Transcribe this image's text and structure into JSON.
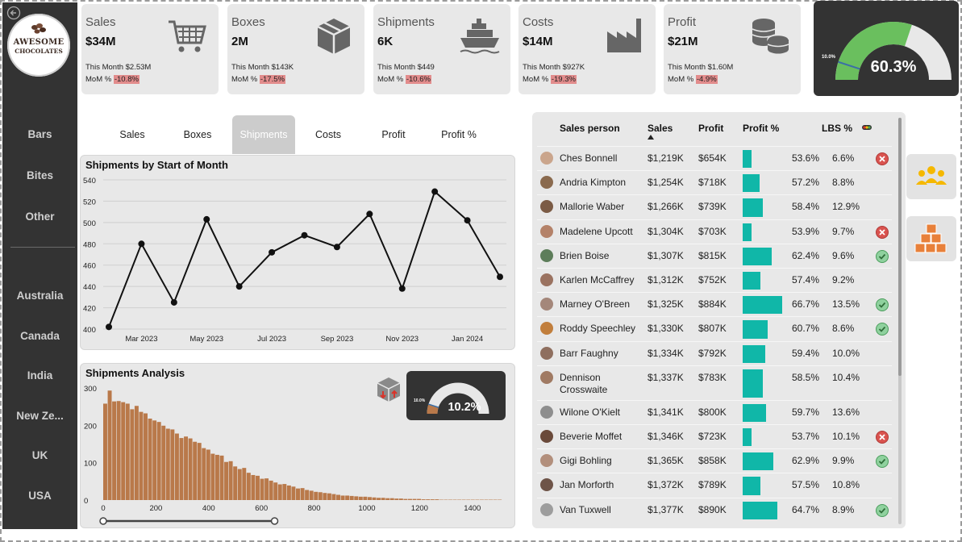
{
  "brand": {
    "line1": "AWESOME",
    "line2": "CHOCOLATES"
  },
  "nav": {
    "categories": [
      "Bars",
      "Bites",
      "Other"
    ],
    "countries": [
      "Australia",
      "Canada",
      "India",
      "New Ze...",
      "UK",
      "USA"
    ]
  },
  "kpis": [
    {
      "label": "Sales",
      "value": "$34M",
      "month": "This Month $2.53M",
      "mom_prefix": "MoM % ",
      "mom": "-10.8%",
      "icon": "cart-icon"
    },
    {
      "label": "Boxes",
      "value": "2M",
      "month": "This Month $143K",
      "mom_prefix": "MoM % ",
      "mom": "-17.5%",
      "icon": "box-icon"
    },
    {
      "label": "Shipments",
      "value": "6K",
      "month": "This Month $449",
      "mom_prefix": "MoM % ",
      "mom": "-10.6%",
      "icon": "ship-icon"
    },
    {
      "label": "Costs",
      "value": "$14M",
      "month": "This Month $927K",
      "mom_prefix": "MoM % ",
      "mom": "-19.3%",
      "icon": "factory-icon"
    },
    {
      "label": "Profit",
      "value": "$21M",
      "month": "This Month $1.60M",
      "mom_prefix": "MoM % ",
      "mom": "-4.9%",
      "icon": "coins-icon"
    }
  ],
  "profit_gauge": {
    "value": "60.3%",
    "target_label": "10.0%",
    "fraction": 0.603,
    "target_fraction": 0.1,
    "colors": {
      "fill": "#6abf5e",
      "track": "#e8e8e8"
    }
  },
  "tabs": [
    "Sales",
    "Boxes",
    "Shipments",
    "Costs",
    "Profit",
    "Profit %"
  ],
  "active_tab": "Shipments",
  "line_chart": {
    "title": "Shipments by Start of Month",
    "chart_data": {
      "type": "line",
      "x": [
        "Feb 2023",
        "Mar 2023",
        "Apr 2023",
        "May 2023",
        "Jun 2023",
        "Jul 2023",
        "Aug 2023",
        "Sep 2023",
        "Oct 2023",
        "Nov 2023",
        "Dec 2023",
        "Jan 2024",
        "Feb 2024"
      ],
      "y": [
        402,
        480,
        425,
        503,
        440,
        472,
        488,
        477,
        508,
        438,
        529,
        502,
        449
      ],
      "x_ticks": [
        "Mar 2023",
        "May 2023",
        "Jul 2023",
        "Sep 2023",
        "Nov 2023",
        "Jan 2024"
      ],
      "y_ticks": [
        400,
        420,
        440,
        460,
        480,
        500,
        520,
        540
      ],
      "ylim": [
        400,
        540
      ]
    }
  },
  "histogram": {
    "title": "Shipments Analysis",
    "chart_data": {
      "type": "bar",
      "bin_width": 17,
      "values": [
        258,
        293,
        264,
        265,
        262,
        258,
        243,
        252,
        236,
        232,
        218,
        213,
        209,
        199,
        191,
        189,
        178,
        166,
        170,
        165,
        156,
        153,
        139,
        135,
        124,
        121,
        119,
        102,
        104,
        90,
        83,
        86,
        73,
        67,
        65,
        57,
        58,
        52,
        47,
        42,
        43,
        39,
        36,
        31,
        32,
        27,
        25,
        22,
        21,
        19,
        18,
        16,
        14,
        12,
        12,
        11,
        10,
        9,
        9,
        8,
        7,
        6,
        6,
        5,
        5,
        4,
        4,
        3,
        3,
        3,
        3,
        2,
        2,
        2,
        2,
        1,
        1,
        1,
        1,
        1,
        1,
        1,
        1,
        1,
        1,
        1,
        1,
        1,
        1
      ],
      "x_ticks": [
        0,
        200,
        400,
        600,
        800,
        1000,
        1200,
        1400
      ],
      "y_ticks": [
        0,
        100,
        200,
        300
      ],
      "xlim": [
        0,
        1520
      ],
      "ylim": [
        0,
        300
      ],
      "color": "#b9794a"
    },
    "slider_range": [
      0,
      650
    ]
  },
  "mini_gauge": {
    "value": "10.2%",
    "target_label": "10.0%",
    "fraction": 0.102
  },
  "table": {
    "headers": [
      "Sales person",
      "Sales",
      "Profit",
      "Profit %",
      "LBS %"
    ],
    "rows": [
      {
        "name": "Ches Bonnell",
        "sales": "$1,219K",
        "profit": "$654K",
        "pct": "53.6%",
        "pct_value": 53.6,
        "lbs": "6.6%",
        "status": "x"
      },
      {
        "name": "Andria Kimpton",
        "sales": "$1,254K",
        "profit": "$718K",
        "pct": "57.2%",
        "pct_value": 57.2,
        "lbs": "8.8%",
        "status": ""
      },
      {
        "name": "Mallorie Waber",
        "sales": "$1,266K",
        "profit": "$739K",
        "pct": "58.4%",
        "pct_value": 58.4,
        "lbs": "12.9%",
        "status": ""
      },
      {
        "name": "Madelene Upcott",
        "sales": "$1,304K",
        "profit": "$703K",
        "pct": "53.9%",
        "pct_value": 53.9,
        "lbs": "9.7%",
        "status": "x"
      },
      {
        "name": "Brien Boise",
        "sales": "$1,307K",
        "profit": "$815K",
        "pct": "62.4%",
        "pct_value": 62.4,
        "lbs": "9.6%",
        "status": "ok"
      },
      {
        "name": "Karlen McCaffrey",
        "sales": "$1,312K",
        "profit": "$752K",
        "pct": "57.4%",
        "pct_value": 57.4,
        "lbs": "9.2%",
        "status": ""
      },
      {
        "name": "Marney O'Breen",
        "sales": "$1,325K",
        "profit": "$884K",
        "pct": "66.7%",
        "pct_value": 66.7,
        "lbs": "13.5%",
        "status": "ok"
      },
      {
        "name": "Roddy Speechley",
        "sales": "$1,330K",
        "profit": "$807K",
        "pct": "60.7%",
        "pct_value": 60.7,
        "lbs": "8.6%",
        "status": "ok"
      },
      {
        "name": "Barr Faughny",
        "sales": "$1,334K",
        "profit": "$792K",
        "pct": "59.4%",
        "pct_value": 59.4,
        "lbs": "10.0%",
        "status": ""
      },
      {
        "name": "Dennison Crosswaite",
        "sales": "$1,337K",
        "profit": "$783K",
        "pct": "58.5%",
        "pct_value": 58.5,
        "lbs": "10.4%",
        "status": ""
      },
      {
        "name": "Wilone O'Kielt",
        "sales": "$1,341K",
        "profit": "$800K",
        "pct": "59.7%",
        "pct_value": 59.7,
        "lbs": "13.6%",
        "status": ""
      },
      {
        "name": "Beverie Moffet",
        "sales": "$1,346K",
        "profit": "$723K",
        "pct": "53.7%",
        "pct_value": 53.7,
        "lbs": "10.1%",
        "status": "x"
      },
      {
        "name": "Gigi Bohling",
        "sales": "$1,365K",
        "profit": "$858K",
        "pct": "62.9%",
        "pct_value": 62.9,
        "lbs": "9.9%",
        "status": "ok"
      },
      {
        "name": "Jan Morforth",
        "sales": "$1,372K",
        "profit": "$789K",
        "pct": "57.5%",
        "pct_value": 57.5,
        "lbs": "10.8%",
        "status": ""
      },
      {
        "name": "Van Tuxwell",
        "sales": "$1,377K",
        "profit": "$890K",
        "pct": "64.7%",
        "pct_value": 64.7,
        "lbs": "8.9%",
        "status": "ok"
      }
    ]
  },
  "colors": {
    "sidebar": "#333333",
    "teal_bar": "#10b7a8",
    "panel": "#e8e8e8",
    "icon_orange": "#e8803a",
    "icon_yellow": "#f5b800"
  }
}
